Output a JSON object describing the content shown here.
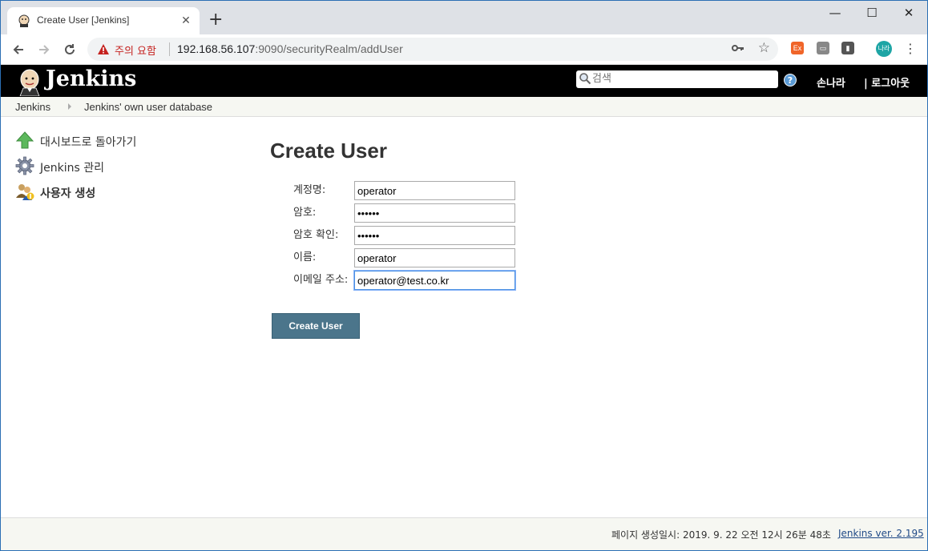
{
  "browser": {
    "tab_title": "Create User [Jenkins]",
    "tab_close": "✕",
    "new_tab": "+",
    "window_controls": {
      "minimize": "—",
      "maximize": "☐",
      "close": "✕"
    },
    "security_warning": "주의 요함",
    "url_host": "192.168.56.107",
    "url_rest": ":9090/securityRealm/addUser",
    "extensions": [
      {
        "name": "ex-extension",
        "label": "Ex",
        "color": "#f06529"
      },
      {
        "name": "reader-extension",
        "label": "▭",
        "color": "#888888"
      },
      {
        "name": "bar-extension",
        "label": "▮",
        "color": "#555555"
      }
    ],
    "profile_avatar": "나라"
  },
  "header": {
    "title": "Jenkins",
    "search_placeholder": "검색",
    "help": "?",
    "user": "손나라",
    "logout": "| 로그아웃"
  },
  "breadcrumb": {
    "items": [
      "Jenkins",
      "Jenkins' own user database"
    ]
  },
  "sidebar": {
    "items": [
      {
        "label": "대시보드로 돌아가기",
        "icon": "up-arrow-icon",
        "bold": false
      },
      {
        "label": "Jenkins 관리",
        "icon": "gear-icon",
        "bold": false
      },
      {
        "label": "사용자 생성",
        "icon": "users-icon",
        "bold": true
      }
    ]
  },
  "form": {
    "title": "Create User",
    "fields": [
      {
        "label": "계정명:",
        "value": "operator",
        "type": "text"
      },
      {
        "label": "암호:",
        "value": "••••••",
        "type": "password"
      },
      {
        "label": "암호 확인:",
        "value": "••••••",
        "type": "password"
      },
      {
        "label": "이름:",
        "value": "operator",
        "type": "text"
      },
      {
        "label": "이메일 주소:",
        "value": "operator@test.co.kr",
        "type": "text"
      }
    ],
    "submit_label": "Create User"
  },
  "footer": {
    "generated": "페이지 생성일시: 2019. 9. 22 오전 12시 26분 48초",
    "version": "Jenkins ver. 2.195"
  }
}
